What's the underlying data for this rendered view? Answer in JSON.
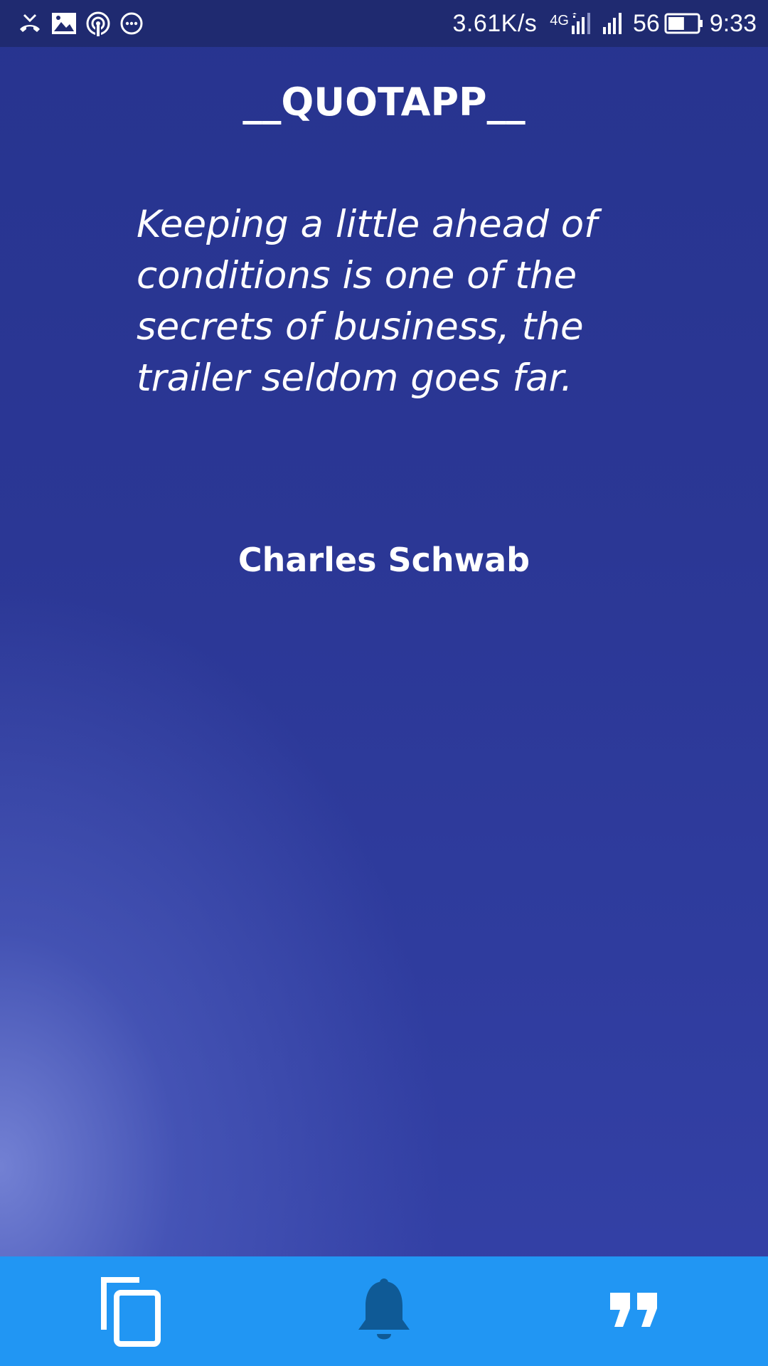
{
  "status_bar": {
    "icons": [
      "missed-call-icon",
      "image-icon",
      "hotspot-icon",
      "more-icon",
      "signal-icon",
      "battery-icon"
    ],
    "net_speed": "3.61K/s",
    "net_type": "4G",
    "battery_level": "56",
    "battery_fraction": 0.56,
    "time": "9:33"
  },
  "app": {
    "title": "__QUOTAPP__"
  },
  "quote": {
    "text": "Keeping a little ahead of conditions is one of the secrets of business, the trailer seldom goes far.",
    "author": "Charles Schwab"
  },
  "bottom_nav": {
    "items": [
      {
        "icon": "copy-icon"
      },
      {
        "icon": "bell-icon"
      },
      {
        "icon": "quote-icon"
      }
    ]
  },
  "colors": {
    "status_bar": "#1f2a70",
    "background_top": "#27348f",
    "background_glow": "#7684d6",
    "nav_bar": "#2196f3",
    "bell": "#0f5a96",
    "text": "#ffffff"
  }
}
